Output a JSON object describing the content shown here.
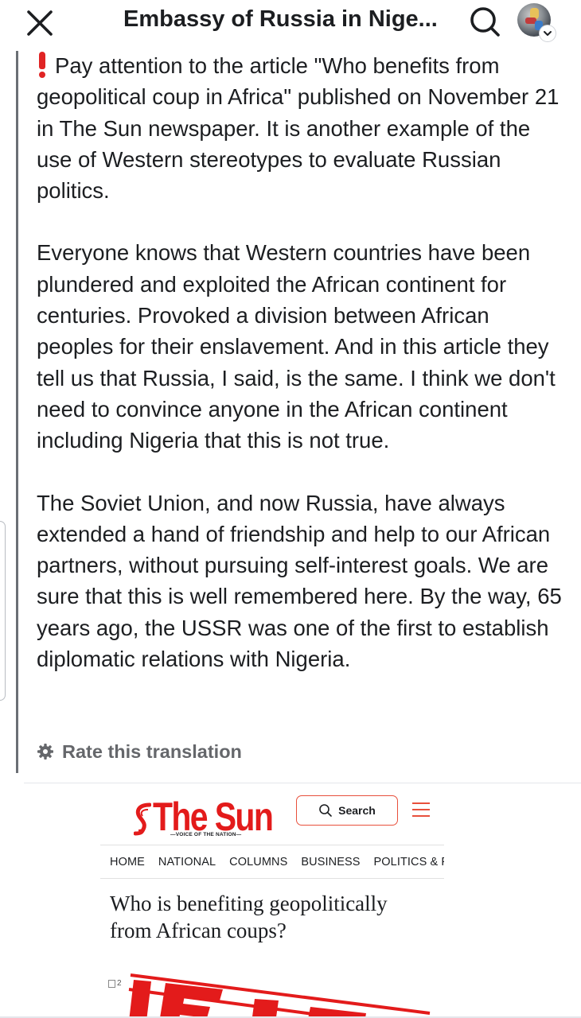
{
  "header": {
    "page_name": "Embassy of Russia in Nige...",
    "close_icon": "close-icon",
    "search_icon": "search-icon",
    "avatar_icon": "profile-avatar"
  },
  "post": {
    "paragraph_1": "Pay attention to the article \"Who benefits from geopolitical coup in Africa\" published on November 21 in The Sun newspaper. It is another example of the use of Western stereotypes to evaluate Russian politics.",
    "paragraph_2": "Everyone knows that Western countries have been plundered and exploited the African continent for centuries. Provoked a division between African peoples for their enslavement. And in this article they tell us that Russia, I said, is the same. I think we don't need to convince anyone in the African continent including Nigeria that this is not true.",
    "paragraph_3": "The Soviet Union, and now Russia, have always extended a hand of friendship and help to our African partners, without pursuing self-interest goals. We are sure that this is well remembered here. By the way, 65 years ago, the USSR was one of the first to establish diplomatic relations with Nigeria.",
    "exclamation_icon": "red-exclamation-icon",
    "rate_translation": "Rate this translation"
  },
  "embedded_screenshot": {
    "logo": "The Sun",
    "tagline": "VOICE OF THE NATION",
    "search_label": "Search",
    "nav": [
      "HOME",
      "NATIONAL",
      "COLUMNS",
      "BUSINESS",
      "POLITICS & F"
    ],
    "headline": "Who is benefiting geopolitically from African coups?",
    "meta": "2",
    "stamp_color": "#e31b1b"
  },
  "colors": {
    "accent_red": "#e31b1b",
    "text": "#1c1e21",
    "muted": "#65676b"
  }
}
